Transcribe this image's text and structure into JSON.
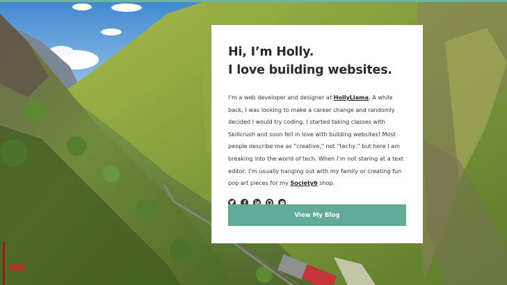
{
  "headline": {
    "line1": "Hi, I’m Holly.",
    "line2": "I love building websites."
  },
  "bio": {
    "part1": "I’m a web developer and designer at ",
    "link1": "HollyLlama",
    "part2": ". A while back, I was looking to make a career change and randomly decided I would try coding. I started taking classes with Skillcrush and soon fell in love with building websites! Most people describe me as “creative,” not “techy,” but here I am breaking into the world of tech. When I’m not staring at a text editor, I’m usually hanging out with my family or creating fun pop art pieces for my ",
    "link2": "Society6",
    "part3": " shop."
  },
  "social": [
    "twitter-icon",
    "facebook-icon",
    "linkedin-icon",
    "github-icon",
    "email-icon"
  ],
  "cta": {
    "label": "View My Blog"
  },
  "colors": {
    "accent": "#61ab98",
    "top_stripe": "#6fb3a3",
    "heading": "#2a2a2a",
    "body_text": "#333333"
  }
}
